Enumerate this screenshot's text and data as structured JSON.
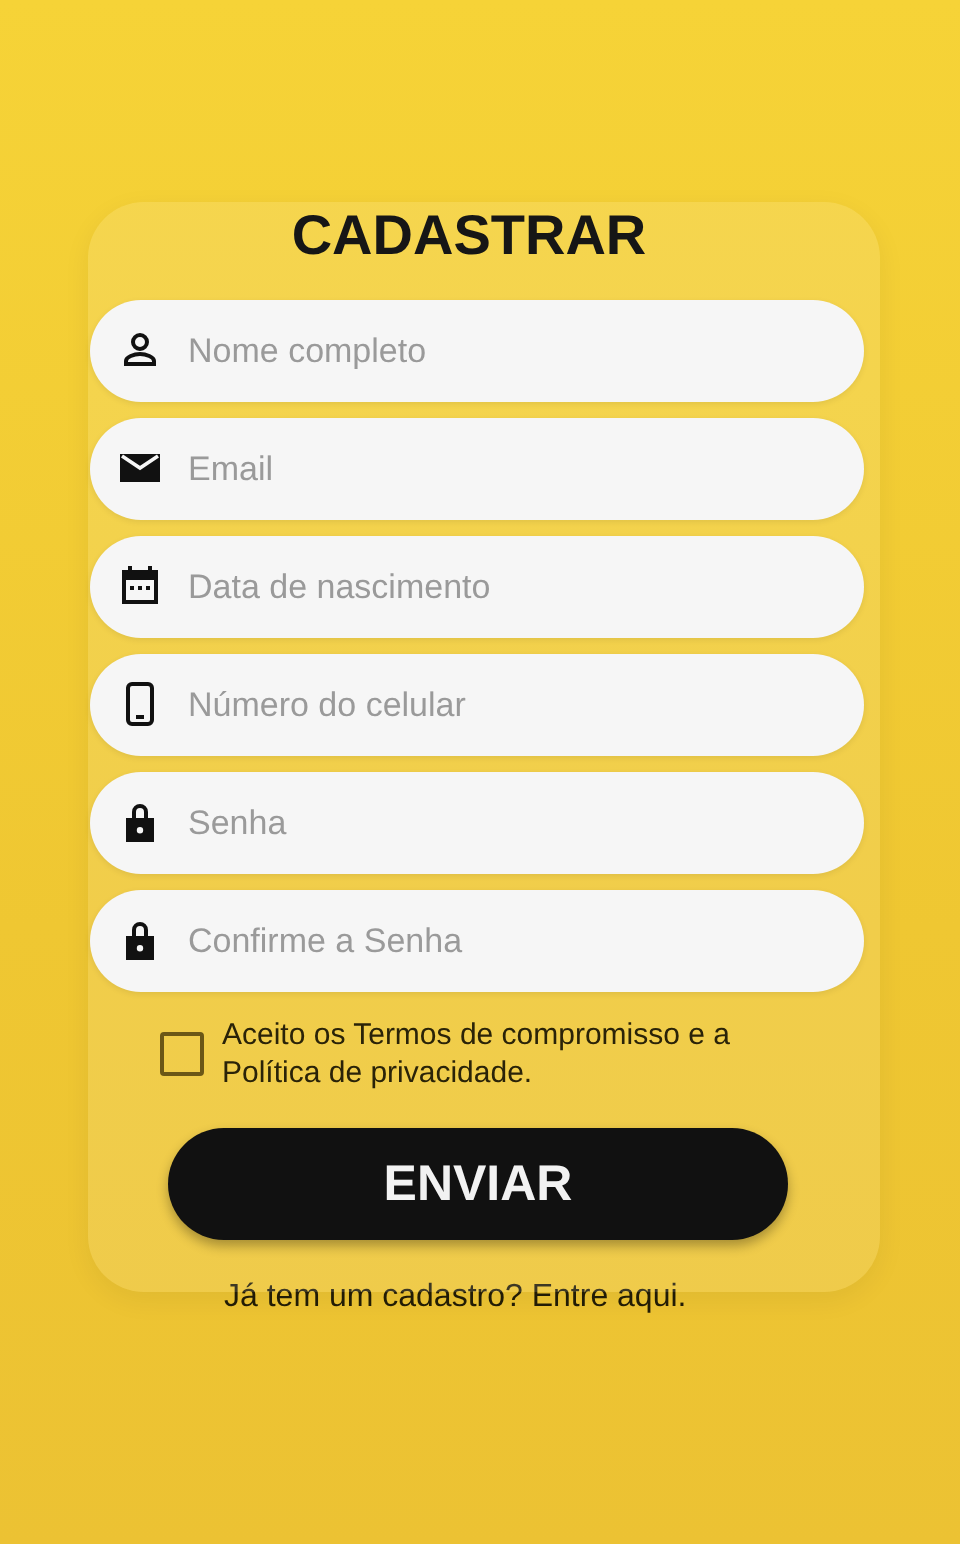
{
  "title": "CADASTRAR",
  "fields": [
    {
      "kind": "person",
      "placeholder": "Nome completo"
    },
    {
      "kind": "mail",
      "placeholder": "Email"
    },
    {
      "kind": "calendar",
      "placeholder": "Data de nascimento"
    },
    {
      "kind": "phone",
      "placeholder": "Número do celular"
    },
    {
      "kind": "lock",
      "placeholder": "Senha"
    },
    {
      "kind": "lock",
      "placeholder": "Confirme a Senha"
    }
  ],
  "terms": {
    "label": "Aceito os Termos de compromisso e a Política de privacidade.",
    "checked": false
  },
  "submit": "ENVIAR",
  "login_link": "Já tem um cadastro? Entre aqui."
}
